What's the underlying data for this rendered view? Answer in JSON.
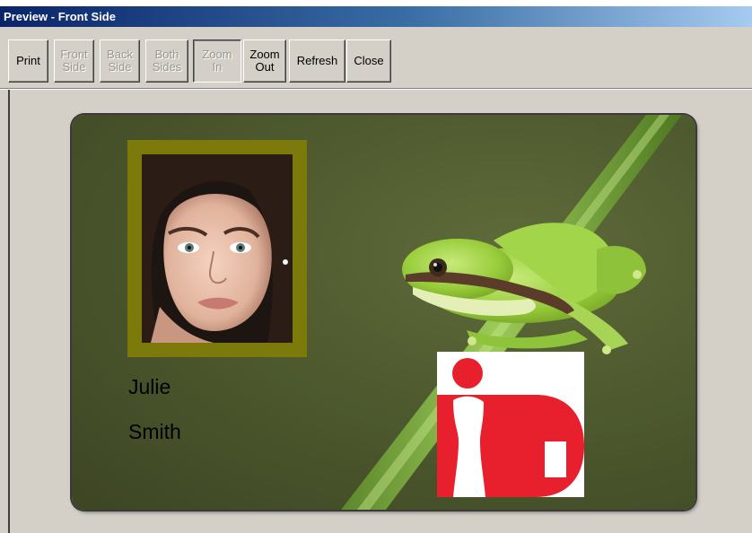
{
  "window": {
    "title": "Preview - Front Side"
  },
  "toolbar": {
    "print": "Print",
    "front_side": "Front\nSide",
    "back_side": "Back\nSide",
    "both_sides": "Both\nSides",
    "zoom_in": "Zoom\nIn",
    "zoom_out": "Zoom\nOut",
    "refresh": "Refresh",
    "close": "Close"
  },
  "card": {
    "first_name": "Julie",
    "last_name": "Smith",
    "frame_color": "#7b7a0a",
    "background_color": "#4e5a2e",
    "logo_color": "#e8202e"
  },
  "icons": [
    "frog-image",
    "portrait-photo",
    "id-logo"
  ]
}
